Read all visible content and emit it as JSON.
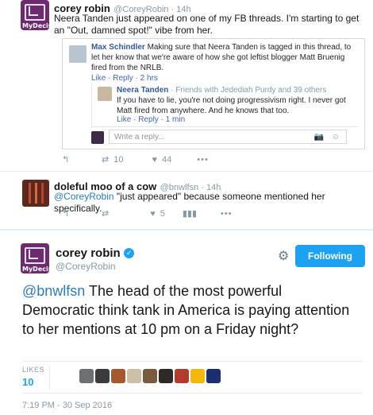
{
  "tweet1": {
    "author": "corey robin",
    "handle": "@CoreyRobin · 14h",
    "avatar_tag": "MyDecision",
    "text": "Neera Tanden just appeared on one of my FB threads. I'm starting to get an \"Out, damned spot!\" vibe from her.",
    "fb": {
      "comment1": {
        "name": "Max Schindler",
        "text": " Making sure that Neera Tanden is tagged in this thread, to let her know that we're aware of how she got leftist blogger Matt Bruenig fired from the NRLB.",
        "actions": "Like · Reply · 2 hrs"
      },
      "comment2": {
        "name": "Neera Tanden",
        "meta": " · Friends with Jedediah Purdy and 39 others",
        "text": "If you have to lie, you're not doing progressivism right. I never got Matt fired from anywhere. And he knows that too.",
        "actions": "Like · Reply · 1 min"
      },
      "reply_placeholder": "Write a reply..."
    },
    "retweets": "10",
    "likes": "44"
  },
  "tweet2": {
    "author": "doleful moo of a cow",
    "handle": "@bnwlfsn · 14h",
    "mention": "@CoreyRobin",
    "text": " \"just appeared\" because someone mentioned her specifically.",
    "likes": "5"
  },
  "main": {
    "author": "corey robin",
    "handle": "@CoreyRobin",
    "avatar_tag": "MyDecision",
    "follow_label": "Following",
    "mention": "@bnwlfsn",
    "text": " The head of the most powerful Democratic think tank in America is paying attention to her mentions at 10 pm on a Friday night?",
    "likes_label": "LIKES",
    "likes_count": "10",
    "timestamp": "7:19 PM - 30 Sep 2016"
  },
  "colors": {
    "accent": "#1da1f2",
    "link": "#2b7bb9",
    "avatar": "#6b2c6e"
  }
}
